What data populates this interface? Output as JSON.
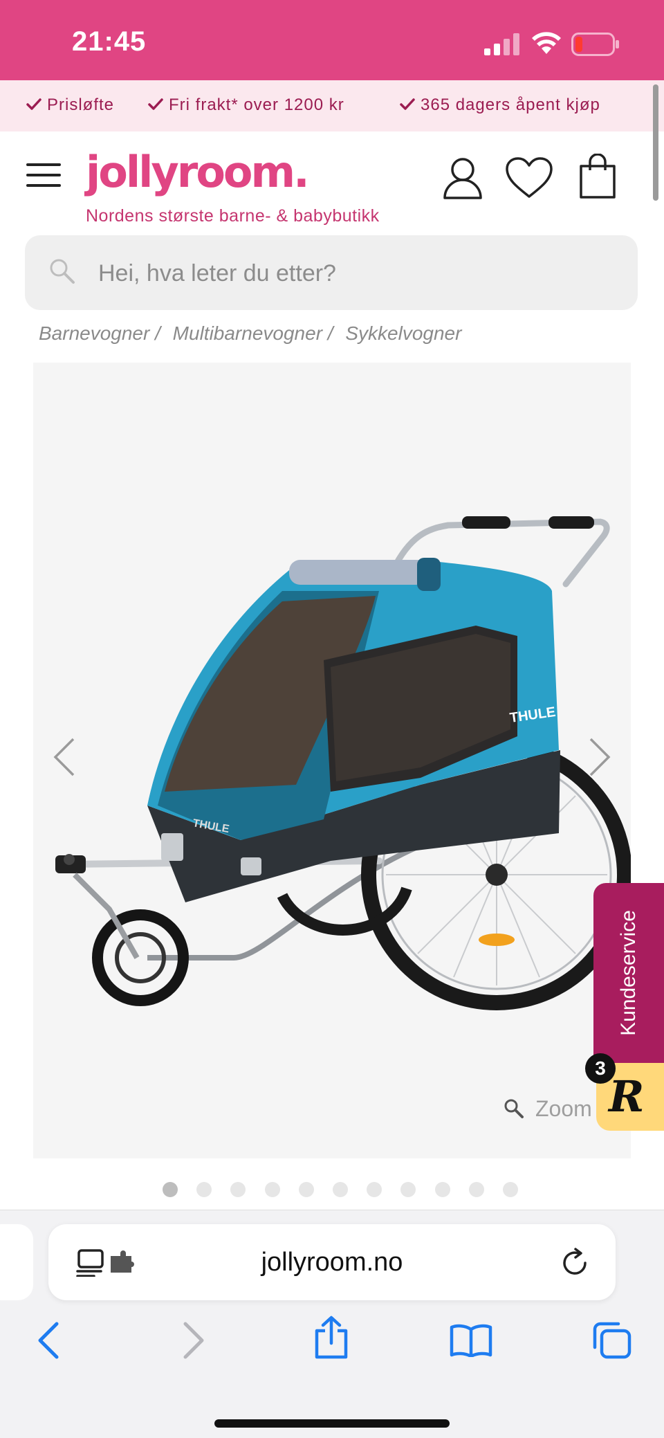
{
  "status_bar": {
    "time": "21:45"
  },
  "usp": [
    {
      "label": "Prisløfte"
    },
    {
      "label": "Fri frakt* over 1200 kr"
    },
    {
      "label": "365 dagers åpent kjøp"
    }
  ],
  "header": {
    "logo": "jollyroom.",
    "tagline": "Nordens største barne- & babybutikk"
  },
  "search": {
    "placeholder": "Hei, hva leter du etter?"
  },
  "breadcrumb": [
    "Barnevogner /",
    "Multibarnevogner /",
    "Sykkelvogner"
  ],
  "gallery": {
    "zoom_label": "Zoom",
    "dot_count": 11,
    "active_index": 0
  },
  "widgets": {
    "kundeservice": "Kundeservice",
    "reviews_letter": "R",
    "reviews_badge": "3"
  },
  "browser": {
    "url": "jollyroom.no"
  },
  "colors": {
    "brand_pink": "#e04583",
    "usp_background": "#fbe8ee",
    "usp_text": "#9b1c51",
    "kundeservice": "#a81d5e",
    "reviews": "#ffd87a",
    "ios_blue": "#1e7cf0"
  }
}
